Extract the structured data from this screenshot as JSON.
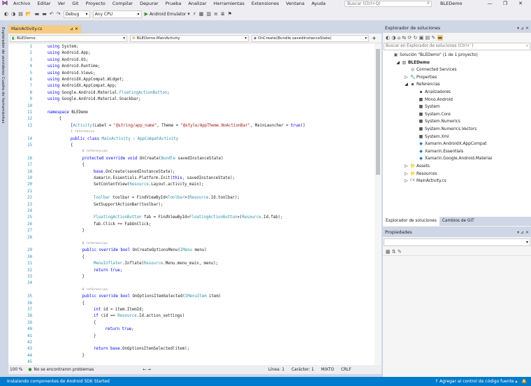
{
  "menu": [
    "Archivo",
    "Editar",
    "Ver",
    "Git",
    "Proyecto",
    "Compilar",
    "Depurar",
    "Prueba",
    "Analizar",
    "Herramientas",
    "Extensiones",
    "Ventana",
    "Ayuda"
  ],
  "search_placeholder": "Buscar (Ctrl+Q)",
  "project_title": "BLEDemo",
  "window_buttons": [
    "—",
    "❐",
    "✕"
  ],
  "toolbar": {
    "config": "Debug",
    "platform": "Any CPU",
    "run_target": "Android Emulator"
  },
  "left_strip": "Explorador de servidores   Cuadro de herramientas",
  "doc_tab": {
    "label": "MainActivity.cs",
    "pin": "⊿",
    "close": "✕"
  },
  "nav": {
    "project": "BLEDemo",
    "class": "BLEDemo.MainActivity",
    "member": "OnCreate(Bundle savedInstanceState)"
  },
  "code_lines": [
    {
      "n": "1",
      "ind": 0,
      "ref": false,
      "t": "using System;"
    },
    {
      "n": "2",
      "ind": 0,
      "ref": false,
      "t": "using Android.App;"
    },
    {
      "n": "3",
      "ind": 0,
      "ref": false,
      "t": "using Android.OS;"
    },
    {
      "n": "4",
      "ind": 0,
      "ref": false,
      "t": "using Android.Runtime;"
    },
    {
      "n": "5",
      "ind": 0,
      "ref": false,
      "t": "using Android.Views;"
    },
    {
      "n": "6",
      "ind": 0,
      "ref": false,
      "t": "using AndroidX.AppCompat.Widget;"
    },
    {
      "n": "7",
      "ind": 0,
      "ref": false,
      "t": "using AndroidX.AppCompat.App;"
    },
    {
      "n": "8",
      "ind": 0,
      "ref": false,
      "t": "using Google.Android.Material.FloatingActionButton;"
    },
    {
      "n": "9",
      "ind": 0,
      "ref": false,
      "t": "using Google.Android.Material.Snackbar;"
    },
    {
      "n": "10",
      "ind": 0,
      "ref": false,
      "t": ""
    },
    {
      "n": "11",
      "ind": 0,
      "ref": false,
      "t": "namespace BLEDemo"
    },
    {
      "n": "12",
      "ind": 1,
      "ref": false,
      "t": "{"
    },
    {
      "n": "13",
      "ind": 2,
      "ref": false,
      "t": "[Activity(Label = \"@string/app_name\", Theme = \"@style/AppTheme.NoActionBar\", MainLauncher = true)]"
    },
    {
      "n": "",
      "ind": 2,
      "ref": true,
      "t": "1 referencia"
    },
    {
      "n": "14",
      "ind": 2,
      "ref": false,
      "t": "public class MainActivity : AppCompatActivity"
    },
    {
      "n": "15",
      "ind": 2,
      "ref": false,
      "t": "{"
    },
    {
      "n": "",
      "ind": 3,
      "ref": true,
      "t": "0 referencias"
    },
    {
      "n": "16",
      "ind": 3,
      "ref": false,
      "t": "protected override void OnCreate(Bundle savedInstanceState)"
    },
    {
      "n": "17",
      "ind": 3,
      "ref": false,
      "t": "{"
    },
    {
      "n": "18",
      "ind": 4,
      "ref": false,
      "t": "base.OnCreate(savedInstanceState);"
    },
    {
      "n": "19",
      "ind": 4,
      "ref": false,
      "t": "Xamarin.Essentials.Platform.Init(this, savedInstanceState);"
    },
    {
      "n": "20",
      "ind": 4,
      "ref": false,
      "t": "SetContentView(Resource.Layout.activity_main);"
    },
    {
      "n": "21",
      "ind": 4,
      "ref": false,
      "t": ""
    },
    {
      "n": "22",
      "ind": 4,
      "ref": false,
      "t": "Toolbar toolbar = FindViewById<Toolbar>(Resource.Id.toolbar);"
    },
    {
      "n": "23",
      "ind": 4,
      "ref": false,
      "t": "SetSupportActionBar(toolbar);"
    },
    {
      "n": "24",
      "ind": 4,
      "ref": false,
      "t": ""
    },
    {
      "n": "25",
      "ind": 4,
      "ref": false,
      "t": "FloatingActionButton fab = FindViewById<FloatingActionButton>(Resource.Id.fab);"
    },
    {
      "n": "26",
      "ind": 4,
      "ref": false,
      "t": "fab.Click += FabOnClick;"
    },
    {
      "n": "27",
      "ind": 3,
      "ref": false,
      "t": "}"
    },
    {
      "n": "28",
      "ind": 3,
      "ref": false,
      "t": ""
    },
    {
      "n": "",
      "ind": 3,
      "ref": true,
      "t": "0 referencias"
    },
    {
      "n": "29",
      "ind": 3,
      "ref": false,
      "t": "public override bool OnCreateOptionsMenu(IMenu menu)"
    },
    {
      "n": "30",
      "ind": 3,
      "ref": false,
      "t": "{"
    },
    {
      "n": "31",
      "ind": 4,
      "ref": false,
      "t": "MenuInflater.Inflate(Resource.Menu.menu_main, menu);"
    },
    {
      "n": "32",
      "ind": 4,
      "ref": false,
      "t": "return true;"
    },
    {
      "n": "33",
      "ind": 3,
      "ref": false,
      "t": "}"
    },
    {
      "n": "34",
      "ind": 3,
      "ref": false,
      "t": ""
    },
    {
      "n": "",
      "ind": 3,
      "ref": true,
      "t": "0 referencias"
    },
    {
      "n": "35",
      "ind": 3,
      "ref": false,
      "t": "public override bool OnOptionsItemSelected(IMenuItem item)"
    },
    {
      "n": "36",
      "ind": 3,
      "ref": false,
      "t": "{"
    },
    {
      "n": "37",
      "ind": 4,
      "ref": false,
      "t": "int id = item.ItemId;"
    },
    {
      "n": "38",
      "ind": 4,
      "ref": false,
      "t": "if (id == Resource.Id.action_settings)"
    },
    {
      "n": "39",
      "ind": 4,
      "ref": false,
      "t": "{"
    },
    {
      "n": "40",
      "ind": 5,
      "ref": false,
      "t": "return true;"
    },
    {
      "n": "41",
      "ind": 4,
      "ref": false,
      "t": "}"
    },
    {
      "n": "42",
      "ind": 4,
      "ref": false,
      "t": ""
    },
    {
      "n": "43",
      "ind": 4,
      "ref": false,
      "t": "return base.OnOptionsItemSelected(item);"
    },
    {
      "n": "44",
      "ind": 3,
      "ref": false,
      "t": "}"
    },
    {
      "n": "45",
      "ind": 3,
      "ref": false,
      "t": ""
    }
  ],
  "editor_status": {
    "zoom": "100 %",
    "problems": "No se encontraron problemas",
    "line": "Línea: 1",
    "col": "Carácter: 1",
    "mode": "MIXTO",
    "eol": "CRLF"
  },
  "solution_explorer": {
    "title": "Explorador de soluciones",
    "search_placeholder": "Buscar en Explorador de soluciones (Ctrl+`)",
    "tree": [
      {
        "level": 0,
        "arrow": "",
        "icon": "▣",
        "label": "Solución \"BLEDemo\" (1 de 1 proyecto)",
        "bold": false
      },
      {
        "level": 1,
        "arrow": "◢",
        "icon": "▨",
        "label": "BLEDemo",
        "bold": true
      },
      {
        "level": 2,
        "arrow": "",
        "icon": "◎",
        "label": "Connected Services",
        "bold": false
      },
      {
        "level": 2,
        "arrow": "▷",
        "icon": "🔧",
        "label": "Properties",
        "bold": false
      },
      {
        "level": 2,
        "arrow": "◢",
        "icon": "▪",
        "label": "Referencias",
        "bold": false
      },
      {
        "level": 3,
        "arrow": "",
        "icon": "▪",
        "label": "Analizadores",
        "bold": false
      },
      {
        "level": 3,
        "arrow": "",
        "icon": "■",
        "label": "Mono.Android",
        "bold": false
      },
      {
        "level": 3,
        "arrow": "",
        "icon": "■",
        "label": "System",
        "bold": false
      },
      {
        "level": 3,
        "arrow": "",
        "icon": "■",
        "label": "System.Core",
        "bold": false
      },
      {
        "level": 3,
        "arrow": "",
        "icon": "■",
        "label": "System.Numerics",
        "bold": false
      },
      {
        "level": 3,
        "arrow": "",
        "icon": "■",
        "label": "System.Numerics.Vectors",
        "bold": false
      },
      {
        "level": 3,
        "arrow": "",
        "icon": "■",
        "label": "System.Xml",
        "bold": false
      },
      {
        "level": 3,
        "arrow": "",
        "icon": "◆",
        "label": "Xamarin.AndroidX.AppCompat",
        "bold": false
      },
      {
        "level": 3,
        "arrow": "",
        "icon": "◆",
        "label": "Xamarin.Essentials",
        "bold": false
      },
      {
        "level": 3,
        "arrow": "",
        "icon": "◆",
        "label": "Xamarin.Google.Android.Material",
        "bold": false
      },
      {
        "level": 2,
        "arrow": "▷",
        "icon": "📁",
        "label": "Assets",
        "bold": false
      },
      {
        "level": 2,
        "arrow": "▷",
        "icon": "📁",
        "label": "Resources",
        "bold": false
      },
      {
        "level": 2,
        "arrow": "▷",
        "icon": "C#",
        "label": "MainActivity.cs",
        "bold": false
      }
    ],
    "tabs": [
      "Explorador de soluciones",
      "Cambios de GIT"
    ]
  },
  "properties": {
    "title": "Propiedades"
  },
  "statusbar": {
    "left": "Instalando componentes de Android SDK Started",
    "right": "↑  Agregar al control de código fuente  ▴",
    "bell": "🔔"
  }
}
